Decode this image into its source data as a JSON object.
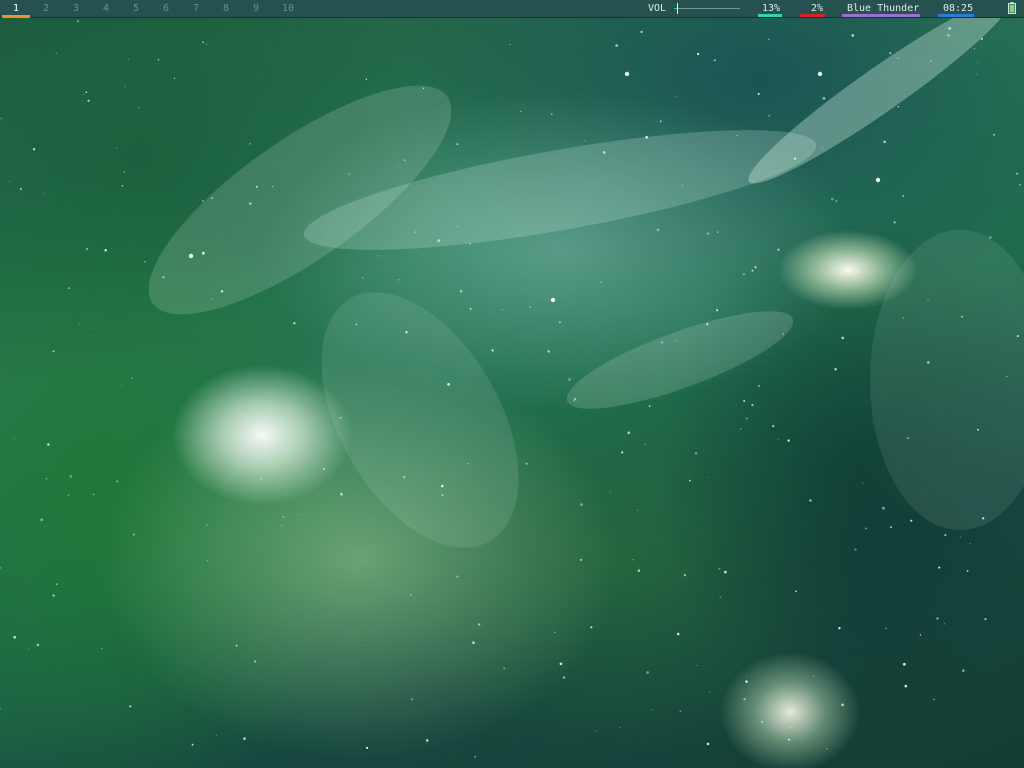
{
  "desktop": {
    "wallpaper": "green-teal nebula space image"
  },
  "topbar": {
    "workspaces": [
      {
        "label": "1",
        "active": true
      },
      {
        "label": "2",
        "active": false
      },
      {
        "label": "3",
        "active": false
      },
      {
        "label": "4",
        "active": false
      },
      {
        "label": "5",
        "active": false
      },
      {
        "label": "6",
        "active": false
      },
      {
        "label": "7",
        "active": false
      },
      {
        "label": "8",
        "active": false
      },
      {
        "label": "9",
        "active": false
      },
      {
        "label": "10",
        "active": false
      }
    ],
    "volume": {
      "label": "VOL",
      "level": 0.05
    },
    "cpu": "13%",
    "mem": "2%",
    "theme": "Blue Thunder",
    "clock": "08:25",
    "battery_icon": "battery-icon",
    "colors": {
      "bar_bg": "#25524e",
      "workspace_active_underline": "#e8952a",
      "cpu_underline": "#2fd3b8",
      "mem_underline": "#d8222a",
      "theme_underline": "#9a6fd6",
      "clock_underline": "#2a7be0",
      "battery_fill": "#7fd67a"
    }
  }
}
